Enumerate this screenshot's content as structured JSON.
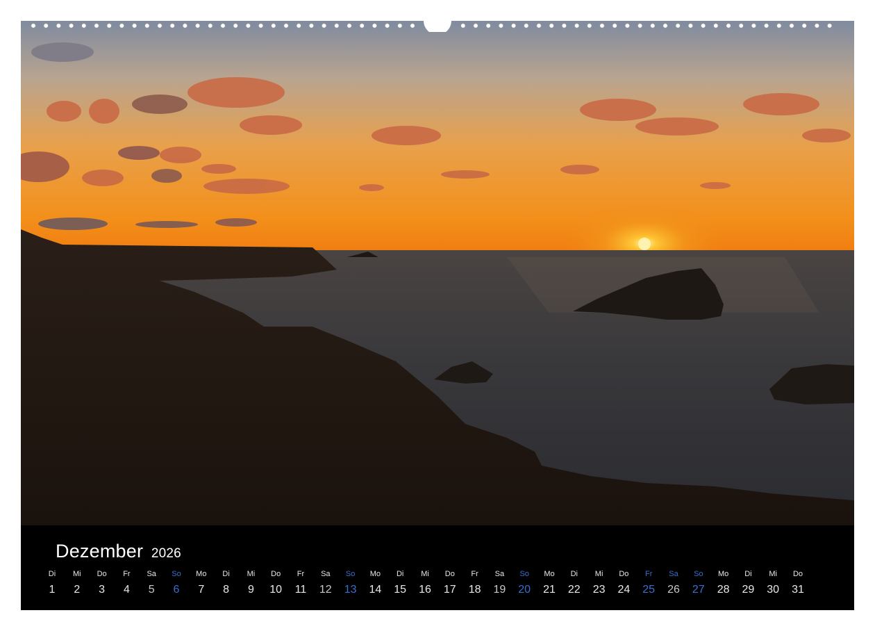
{
  "calendar": {
    "month": "Dezember",
    "year": "2026",
    "days": [
      {
        "dow": "Di",
        "num": "1",
        "blue": false
      },
      {
        "dow": "Mi",
        "num": "2",
        "blue": false
      },
      {
        "dow": "Do",
        "num": "3",
        "blue": false
      },
      {
        "dow": "Fr",
        "num": "4",
        "blue": false
      },
      {
        "dow": "Sa",
        "num": "5",
        "blue": false
      },
      {
        "dow": "So",
        "num": "6",
        "blue": true
      },
      {
        "dow": "Mo",
        "num": "7",
        "blue": false
      },
      {
        "dow": "Di",
        "num": "8",
        "blue": false
      },
      {
        "dow": "Mi",
        "num": "9",
        "blue": false
      },
      {
        "dow": "Do",
        "num": "10",
        "blue": false
      },
      {
        "dow": "Fr",
        "num": "11",
        "blue": false
      },
      {
        "dow": "Sa",
        "num": "12",
        "blue": false
      },
      {
        "dow": "So",
        "num": "13",
        "blue": true
      },
      {
        "dow": "Mo",
        "num": "14",
        "blue": false
      },
      {
        "dow": "Di",
        "num": "15",
        "blue": false
      },
      {
        "dow": "Mi",
        "num": "16",
        "blue": false
      },
      {
        "dow": "Do",
        "num": "17",
        "blue": false
      },
      {
        "dow": "Fr",
        "num": "18",
        "blue": false
      },
      {
        "dow": "Sa",
        "num": "19",
        "blue": false
      },
      {
        "dow": "So",
        "num": "20",
        "blue": true
      },
      {
        "dow": "Mo",
        "num": "21",
        "blue": false
      },
      {
        "dow": "Di",
        "num": "22",
        "blue": false
      },
      {
        "dow": "Mi",
        "num": "23",
        "blue": false
      },
      {
        "dow": "Do",
        "num": "24",
        "blue": false
      },
      {
        "dow": "Fr",
        "num": "25",
        "blue": true
      },
      {
        "dow": "Sa",
        "num": "26",
        "blue": true
      },
      {
        "dow": "So",
        "num": "27",
        "blue": true
      },
      {
        "dow": "Mo",
        "num": "28",
        "blue": false
      },
      {
        "dow": "Di",
        "num": "29",
        "blue": false
      },
      {
        "dow": "Mi",
        "num": "30",
        "blue": false
      },
      {
        "dow": "Do",
        "num": "31",
        "blue": false
      }
    ]
  },
  "colors": {
    "weekend_holiday": "#3a6fd0",
    "sun": "#ffb21e",
    "sky_top": "#7f8ba0",
    "sky_horizon": "#f08a18"
  },
  "photo": {
    "subject": "sunset-over-sea-with-rocky-coast-icon"
  }
}
